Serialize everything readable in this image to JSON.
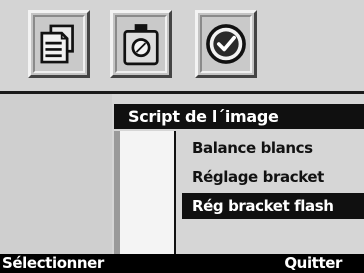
{
  "toolbar": {
    "buttons": [
      {
        "icon": "document-list-icon"
      },
      {
        "icon": "camera-icon"
      },
      {
        "icon": "checkmark-icon"
      }
    ]
  },
  "menu": {
    "title": "Script de l´image",
    "items": [
      {
        "label": "Balance blancs",
        "selected": false
      },
      {
        "label": "Réglage bracket",
        "selected": false
      },
      {
        "label": "Rég bracket flash",
        "selected": true
      }
    ]
  },
  "softkeys": {
    "left_label": "Sélectionner",
    "right_label": "Quitter"
  },
  "colors": {
    "background": "#d6d6d6",
    "highlight": "#101010",
    "highlight_text": "#ffffff"
  }
}
